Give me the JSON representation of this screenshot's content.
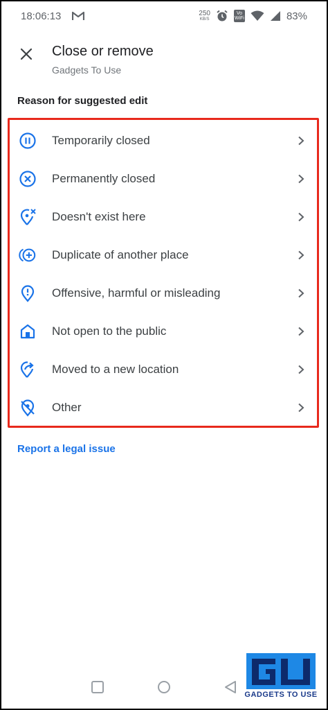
{
  "status_bar": {
    "time": "18:06:13",
    "net_speed_value": "250",
    "net_speed_unit": "KB/S",
    "volte_top": "Vo",
    "volte_bottom": "WiFi",
    "battery": "83%"
  },
  "header": {
    "title": "Close or remove",
    "subtitle": "Gadgets To Use"
  },
  "section_label": "Reason for suggested edit",
  "options": [
    {
      "label": "Temporarily closed",
      "icon": "pause-circle-icon"
    },
    {
      "label": "Permanently closed",
      "icon": "x-circle-icon"
    },
    {
      "label": "Doesn't exist here",
      "icon": "pin-x-icon"
    },
    {
      "label": "Duplicate of another place",
      "icon": "duplicate-plus-icon"
    },
    {
      "label": "Offensive, harmful or misleading",
      "icon": "pin-exclamation-icon"
    },
    {
      "label": "Not open to the public",
      "icon": "house-icon"
    },
    {
      "label": "Moved to a new location",
      "icon": "pin-arrow-icon"
    },
    {
      "label": "Other",
      "icon": "pin-off-icon"
    }
  ],
  "legal_link": "Report a legal issue",
  "watermark": {
    "text": "GADGETS TO USE"
  },
  "colors": {
    "accent": "#1a73e8",
    "highlight_border": "#e8291c",
    "text_primary": "#202124",
    "text_secondary": "#70757a"
  }
}
